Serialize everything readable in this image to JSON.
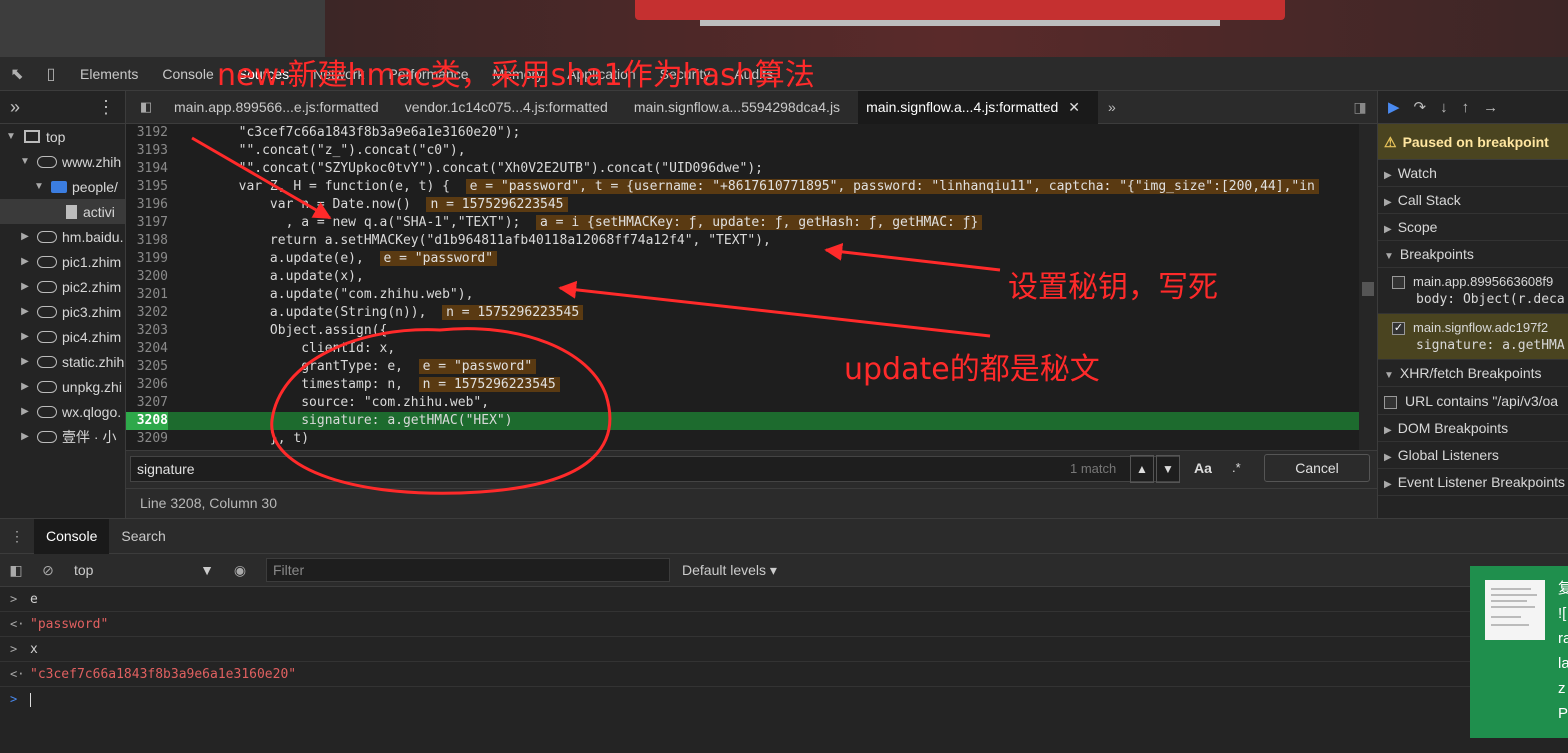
{
  "devtools": {
    "main_tabs": [
      "Elements",
      "Console",
      "Sources",
      "Network",
      "Performance",
      "Memory",
      "Application",
      "Security",
      "Audits"
    ]
  },
  "navigator": {
    "items": [
      {
        "label": "top",
        "kind": "frame"
      },
      {
        "label": "www.zhih",
        "kind": "cloud"
      },
      {
        "label": "people/",
        "kind": "folder"
      },
      {
        "label": "activi",
        "kind": "file"
      },
      {
        "label": "hm.baidu.",
        "kind": "cloud"
      },
      {
        "label": "pic1.zhim",
        "kind": "cloud"
      },
      {
        "label": "pic2.zhim",
        "kind": "cloud"
      },
      {
        "label": "pic3.zhim",
        "kind": "cloud"
      },
      {
        "label": "pic4.zhim",
        "kind": "cloud"
      },
      {
        "label": "static.zhih",
        "kind": "cloud"
      },
      {
        "label": "unpkg.zhi",
        "kind": "cloud"
      },
      {
        "label": "wx.qlogo.",
        "kind": "cloud"
      },
      {
        "label": "壹伴 · 小",
        "kind": "cloud"
      }
    ]
  },
  "editor": {
    "tabs": [
      "main.app.899566...e.js:formatted",
      "vendor.1c14c075...4.js:formatted",
      "main.signflow.a...5594298dca4.js",
      "main.signflow.a...4.js:formatted"
    ],
    "lines": {
      "n3192": "3192",
      "t3192": "        \"c3cef7c66a1843f8b3a9e6a1e3160e20\");",
      "n3193": "3193",
      "t3193": "        \"\".concat(\"z_\").concat(\"c0\"),",
      "n3194": "3194",
      "t3194": "        \"\".concat(\"SZYUpkoc0tvY\").concat(\"Xh0V2E2UTB\").concat(\"UID096dwe\");",
      "n3195": "3195",
      "t3195a": "        var Z, H = function(e, t) {  ",
      "i3195": "e = \"password\", t = {username: \"+8617610771895\", password: \"linhanqiu11\", captcha: \"{\"img_size\":[200,44],\"in",
      "n3196": "3196",
      "t3196a": "            var n = Date.now()  ",
      "i3196": "n = 1575296223545",
      "n3197": "3197",
      "t3197a": "              , a = new q.a(\"SHA-1\",\"TEXT\");  ",
      "i3197": "a = i {setHMACKey: ƒ, update: ƒ, getHash: ƒ, getHMAC: ƒ}",
      "n3198": "3198",
      "t3198": "            return a.setHMACKey(\"d1b964811afb40118a12068ff74a12f4\", \"TEXT\"),",
      "n3199": "3199",
      "t3199a": "            a.update(e),  ",
      "i3199": "e = \"password\"",
      "n3200": "3200",
      "t3200": "            a.update(x),",
      "n3201": "3201",
      "t3201": "            a.update(\"com.zhihu.web\"),",
      "n3202": "3202",
      "t3202a": "            a.update(String(n)),  ",
      "i3202": "n = 1575296223545",
      "n3203": "3203",
      "t3203": "            Object.assign({",
      "n3204": "3204",
      "t3204": "                clientId: x,",
      "n3205": "3205",
      "t3205a": "                grantType: e,  ",
      "i3205": "e = \"password\"",
      "n3206": "3206",
      "t3206a": "                timestamp: n,  ",
      "i3206": "n = 1575296223545",
      "n3207": "3207",
      "t3207": "                source: \"com.zhihu.web\",",
      "n3208": "3208",
      "t3208": "                signature: a.getHMAC(\"HEX\")",
      "n3209": "3209",
      "t3209": "            }, t)"
    }
  },
  "search": {
    "query": "signature",
    "matches": "1 match",
    "aa": "Aa",
    "regex": ".*",
    "cancel": "Cancel"
  },
  "status": {
    "position": "Line 3208, Column 30"
  },
  "debugger": {
    "paused": "Paused on breakpoint",
    "sections": {
      "watch": "Watch",
      "call_stack": "Call Stack",
      "scope": "Scope",
      "breakpoints": "Breakpoints"
    },
    "breakpoints": [
      {
        "file": "main.app.8995663608f9",
        "code": "body: Object(r.deca",
        "checked": false
      },
      {
        "file": "main.signflow.adc197f2",
        "code": "signature: a.getHMA",
        "checked": true
      }
    ],
    "xhr": "XHR/fetch Breakpoints",
    "xhr_item": "URL contains \"/api/v3/oa",
    "dom": "DOM Breakpoints",
    "global": "Global Listeners",
    "event": "Event Listener Breakpoints"
  },
  "drawer": {
    "tabs": [
      "Console",
      "Search"
    ],
    "context": "top",
    "filter_placeholder": "Filter",
    "levels": "Default levels ▾",
    "lines": [
      {
        "kind": "input",
        "text": "e"
      },
      {
        "kind": "output",
        "text": "\"password\""
      },
      {
        "kind": "input",
        "text": "x"
      },
      {
        "kind": "output",
        "text": "\"c3cef7c66a1843f8b3a9e6a1e3160e20\""
      }
    ]
  },
  "notification": {
    "text": "复\n![\nra\nla\nz\nP"
  },
  "annotations": {
    "title": "new:新建hmac类，采用sha1作为hash算法",
    "secret": "设置秘钥，写死",
    "update": "update的都是秘文"
  },
  "colors": {
    "annotation": "#ff2a2a",
    "exec_line": "#1d6b2e",
    "paused_bg": "#4a4420"
  }
}
